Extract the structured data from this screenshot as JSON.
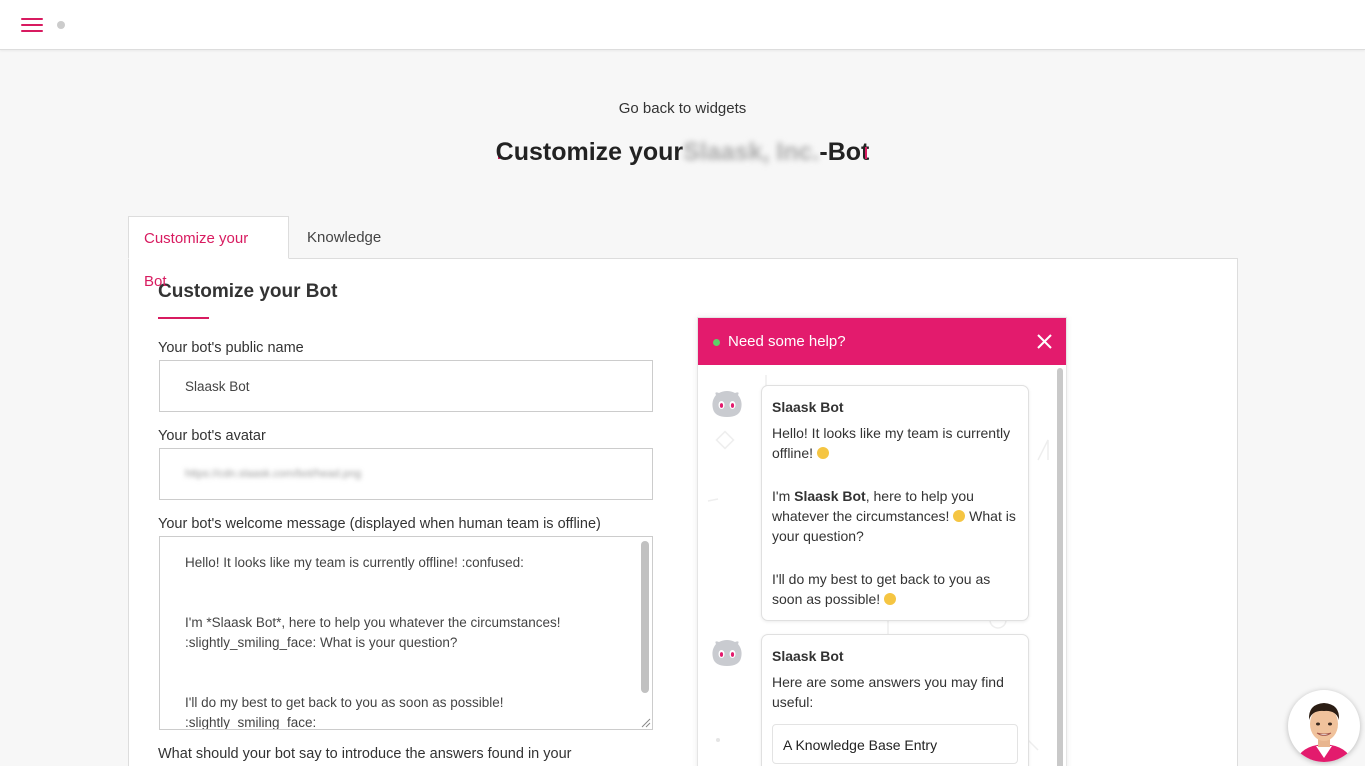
{
  "header": {
    "menu_icon": "hamburger-icon",
    "status_icon": "status-dot-icon"
  },
  "page": {
    "back_link": "Go back to widgets",
    "title_prefix": "Customize your",
    "title_company": "Slaask, Inc.",
    "title_suffix": "-Bot"
  },
  "tabs": [
    {
      "label": "Customize your Bot",
      "active": true
    },
    {
      "label": "Knowledge Base",
      "active": false
    }
  ],
  "form": {
    "section_title": "Customize your Bot",
    "name_label": "Your bot's public name",
    "name_value": "Slaask Bot",
    "avatar_label": "Your bot's avatar",
    "avatar_value": "https://cdn.slaask.com/bot/head.png",
    "welcome_label": "Your bot's welcome message (displayed when human team is offline)",
    "welcome_lines": [
      "Hello! It looks like my team is currently offline! :confused:",
      "I'm *Slaask Bot*, here to help you whatever the circumstances! :slightly_smiling_face: What is your question?",
      "I'll do my best to get back to you as soon as possible! :slightly_smiling_face:"
    ],
    "answers_label": "What should your bot say to introduce the answers found in your"
  },
  "widget": {
    "header_title": "Need some help?",
    "header_color": "#e31b6d",
    "online_color": "#5fd068",
    "close_icon": "close-icon",
    "messages": [
      {
        "sender": "Slaask Bot",
        "p1": "Hello! It looks like my team is currently offline!",
        "p2_pre": "I'm ",
        "p2_bold": "Slaask Bot",
        "p2_post": ", here to help you whatever the circumstances!",
        "p2_tail": " What is your question?",
        "p3": "I'll do my best to get back to you as soon as possible!"
      },
      {
        "sender": "Slaask Bot",
        "text": "Here are some answers you may find useful:",
        "kb_entry": "A Knowledge Base Entry"
      }
    ]
  },
  "colors": {
    "accent": "#d81b60"
  },
  "agent": {
    "avatar_icon": "agent-avatar-icon"
  }
}
